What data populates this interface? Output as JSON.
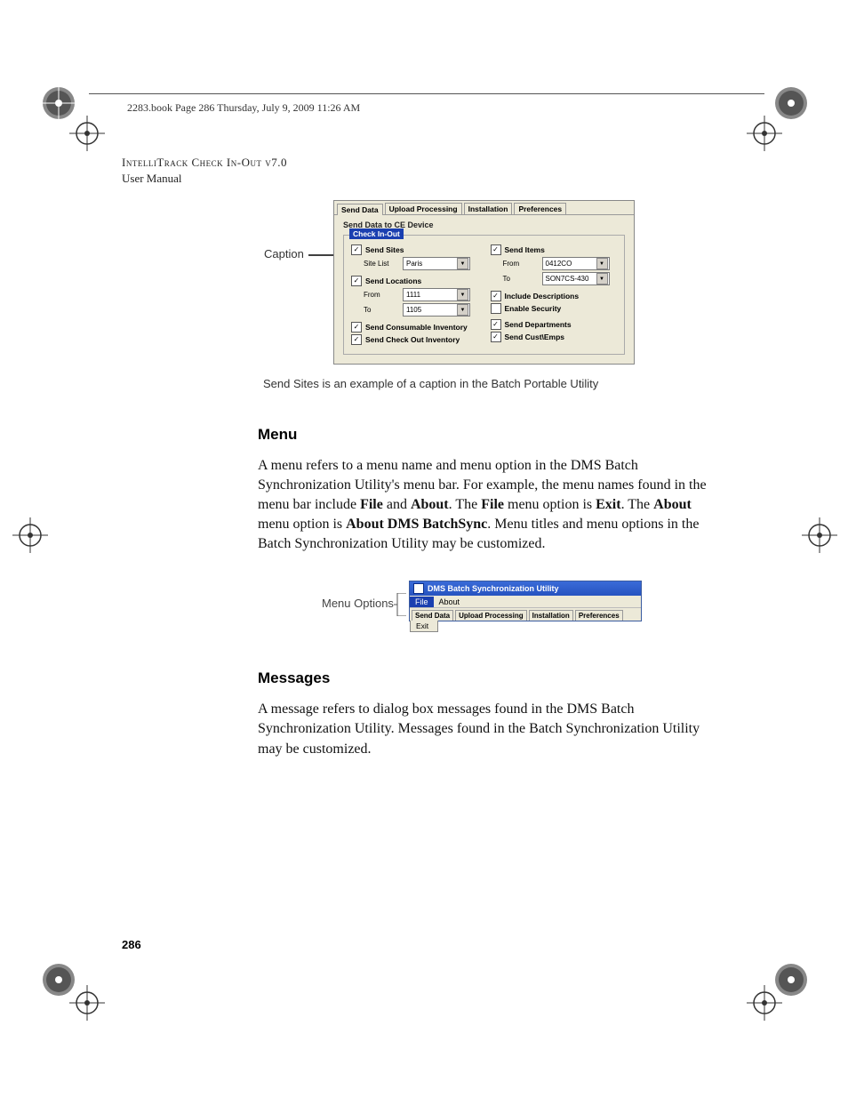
{
  "header_line": "2283.book  Page 286  Thursday, July 9, 2009  11:26 AM",
  "doc_title_line1": "IntelliTrack Check In-Out v7.0",
  "doc_title_line2": "User Manual",
  "caption_label": "Caption",
  "figure1": {
    "tabs": [
      "Send Data",
      "Upload Processing",
      "Installation",
      "Preferences"
    ],
    "panel_title": "Send Data to CE Device",
    "legend": "Check In-Out",
    "left": {
      "send_sites": "Send Sites",
      "site_list_label": "Site List",
      "site_list_value": "Paris",
      "send_locations": "Send Locations",
      "from_label": "From",
      "from_value": "1111",
      "to_label": "To",
      "to_value": "1105",
      "send_consumable": "Send Consumable Inventory",
      "send_checkout": "Send Check Out Inventory"
    },
    "right": {
      "send_items": "Send Items",
      "from_label": "From",
      "from_value": "0412CO",
      "to_label": "To",
      "to_value": "SON7CS-430",
      "include_desc": "Include Descriptions",
      "enable_security": "Enable Security",
      "send_departments": "Send Departments",
      "send_custemps": "Send Cust\\Emps"
    }
  },
  "fig1_caption": "Send Sites is an example of a caption in the Batch Portable Utility",
  "menu_heading": "Menu",
  "menu_body": "A menu refers to a menu name and menu option in the DMS Batch Synchronization Utility's menu bar. For example, the menu names found in the menu bar include <b>File</b> and <b>About</b>. The <b>File</b> menu option is <b>Exit</b>. The <b>About</b> menu option is <b>About DMS BatchSync</b>. Menu titles and menu options in the Batch Synchronization Utility may be customized.",
  "menu_options_label": "Menu Options",
  "figure2": {
    "title": "DMS Batch Synchronization Utility",
    "menus": [
      "File",
      "About"
    ],
    "dropdown": "Exit",
    "tabs": [
      "Send Data",
      "Upload Processing",
      "Installation",
      "Preferences"
    ]
  },
  "messages_heading": "Messages",
  "messages_body": "A message refers to dialog box messages found in the DMS Batch Synchronization Utility. Messages found in the Batch Synchronization Utility may be customized.",
  "page_number": "286"
}
